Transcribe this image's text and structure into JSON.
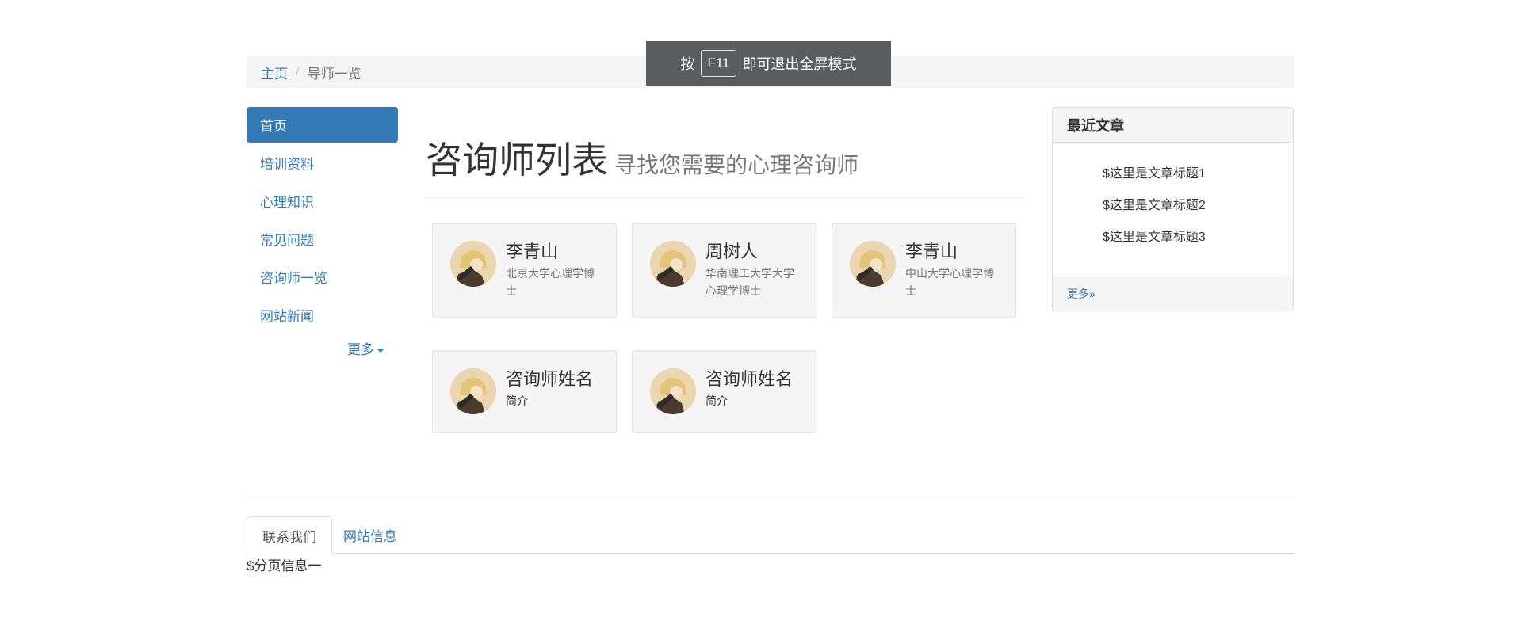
{
  "breadcrumb": {
    "home": "主页",
    "current": "导师一览"
  },
  "fullscreen_notice": {
    "prefix": "按",
    "key": "F11",
    "suffix": "即可退出全屏模式"
  },
  "sidebar": {
    "items": [
      {
        "label": "首页",
        "active": true
      },
      {
        "label": "培训资料",
        "active": false
      },
      {
        "label": "心理知识",
        "active": false
      },
      {
        "label": "常见问题",
        "active": false
      },
      {
        "label": "咨询师一览",
        "active": false
      },
      {
        "label": "网站新闻",
        "active": false
      }
    ],
    "more_label": "更多"
  },
  "header": {
    "title": "咨询师列表",
    "subtitle": "寻找您需要的心理咨询师"
  },
  "counselors": [
    {
      "name": "李青山",
      "desc": "北京大学心理学博士"
    },
    {
      "name": "周树人",
      "desc": "华南理工大学大学心理学博士"
    },
    {
      "name": "李青山",
      "desc": "中山大学心理学博士"
    },
    {
      "name": "咨询师姓名",
      "desc": "简介"
    },
    {
      "name": "咨询师姓名",
      "desc": "简介"
    }
  ],
  "recent_articles": {
    "title": "最近文章",
    "items": [
      "$这里是文章标题1",
      "$这里是文章标题2",
      "$这里是文章标题3"
    ],
    "more_label": "更多»"
  },
  "footer": {
    "tabs": [
      {
        "label": "联系我们",
        "active": true
      },
      {
        "label": "网站信息",
        "active": false
      }
    ],
    "page_info": "$分页信息一"
  },
  "colors": {
    "primary": "#337ab7",
    "panel_bg": "#f5f5f5",
    "toast_bg": "#5a5d60"
  }
}
